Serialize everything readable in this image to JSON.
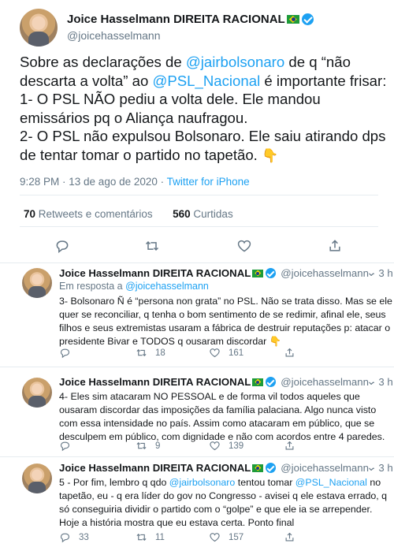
{
  "main_tweet": {
    "name": "Joice Hasselmann DIREITA RACIONAL",
    "handle": "@joicehasselmann",
    "lines": [
      [
        "Sobre as declarações de ",
        "@jairbolsonaro",
        " de q “não"
      ],
      [
        "descarta a volta” ao ",
        "@PSL_Nacional",
        " é importante frisar:"
      ],
      [
        "1- O PSL NÃO pediu a volta dele. Ele mandou"
      ],
      [
        "emissários pq o Aliança naufragou."
      ],
      [
        "2- O PSL não expulsou Bolsonaro. Ele saiu atirando dps"
      ],
      [
        "de tentar tomar o partido no tapetão. ",
        "👇"
      ]
    ],
    "timestamp": "9:28 PM · 13 de ago de 2020 · ",
    "source": "Twitter for iPhone",
    "retweets_count": "70",
    "retweets_label": " Retweets e comentários",
    "likes_count": "560",
    "likes_label": " Curtidas"
  },
  "replies": [
    {
      "name": "Joice Hasselmann DIREITA RACIONAL",
      "handle": "@joicehasselmann",
      "dot": "·",
      "time": "3 h",
      "in_reply_prefix": "Em resposta a ",
      "in_reply_handle": "@joicehasselmann",
      "lines": [
        "3- Bolsonaro Ñ é “persona non grata” no PSL. Não se trata disso. Mas se ele",
        "quer se reconciliar, q tenha o bom sentimento de se redimir, afinal ele, seus",
        "filhos e seus extremistas usaram a fábrica de destruir reputações p: atacar o",
        "presidente Bivar e TODOS q ousaram discordar 👇"
      ],
      "counts": {
        "reply": "",
        "retweet": "18",
        "like": "161"
      }
    },
    {
      "name": "Joice Hasselmann DIREITA RACIONAL",
      "handle": "@joicehasselmann",
      "dot": "·",
      "time": "3 h",
      "lines": [
        "4-  Eles sim atacaram NO PESSOAL e de forma vil todos aqueles que",
        "ousaram discordar das imposições da família palaciana. Algo nunca visto",
        "com essa intensidade no país. Assim como atacaram em público, que se",
        "desculpem em público, com dignidade e não com acordos entre 4 paredes."
      ],
      "counts": {
        "reply": "",
        "retweet": "9",
        "like": "139"
      }
    },
    {
      "name": "Joice Hasselmann DIREITA RACIONAL",
      "handle": "@joicehasselmann",
      "dot": "·",
      "time": "3 h",
      "lines": [
        [
          "5 - Por fim, lembro q qdo ",
          "@jairbolsonaro",
          " tentou tomar ",
          "@PSL_Nacional",
          " no"
        ],
        [
          "tapetão, eu - q era líder do gov no Congresso - avisei q ele estava errado, q"
        ],
        [
          "só conseguiria dividir o partido com o “golpe” e que ele ia se arrepender."
        ],
        [
          "Hoje a história mostra que eu estava certa. Ponto final"
        ]
      ],
      "counts": {
        "reply": "33",
        "retweet": "11",
        "like": "157"
      }
    }
  ],
  "icons": [
    "reply-icon",
    "retweet-icon",
    "like-icon",
    "share-icon",
    "verified-icon",
    "brazil-flag-icon",
    "more-icon"
  ],
  "colors": {
    "link": "#1da1f2",
    "muted": "#657786",
    "text": "#14171a",
    "divider": "#e6ecf0"
  }
}
